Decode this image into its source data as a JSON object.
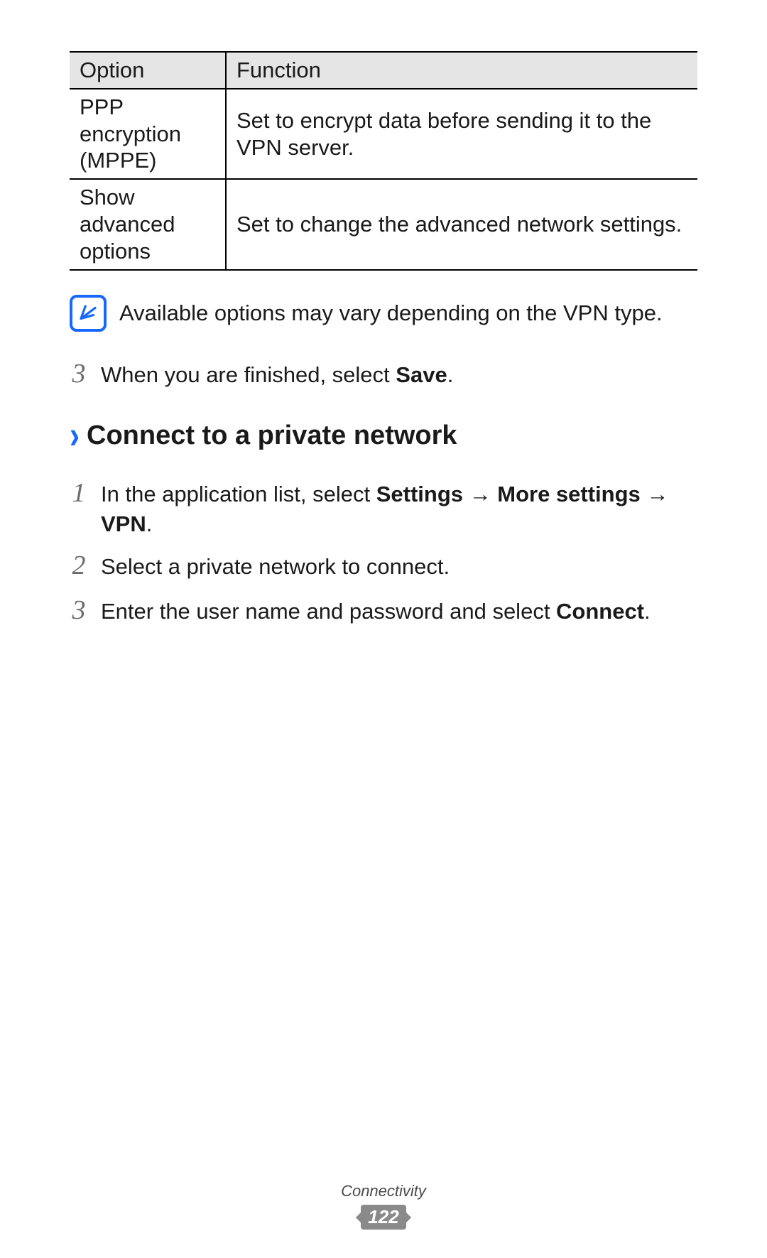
{
  "table": {
    "headers": {
      "option": "Option",
      "function": "Function"
    },
    "rows": [
      {
        "option": "PPP encryption (MPPE)",
        "function": "Set to encrypt data before sending it to the VPN server."
      },
      {
        "option": "Show advanced options",
        "function": "Set to change the advanced network settings."
      }
    ]
  },
  "note": {
    "text": "Available options may vary depending on the VPN type."
  },
  "step_prev": {
    "num": "3",
    "prefix": "When you are finished, select ",
    "bold": "Save",
    "suffix": "."
  },
  "section": {
    "chevron": "›",
    "title": "Connect to a private network"
  },
  "steps": [
    {
      "num": "1",
      "parts": [
        "In the application list, select ",
        "Settings",
        " → ",
        "More settings",
        " → ",
        "VPN",
        "."
      ],
      "boldIdx": [
        1,
        3,
        5
      ]
    },
    {
      "num": "2",
      "parts": [
        "Select a private network to connect."
      ],
      "boldIdx": []
    },
    {
      "num": "3",
      "parts": [
        "Enter the user name and password and select ",
        "Connect",
        "."
      ],
      "boldIdx": [
        1
      ]
    }
  ],
  "footer": {
    "section": "Connectivity",
    "page": "122"
  }
}
